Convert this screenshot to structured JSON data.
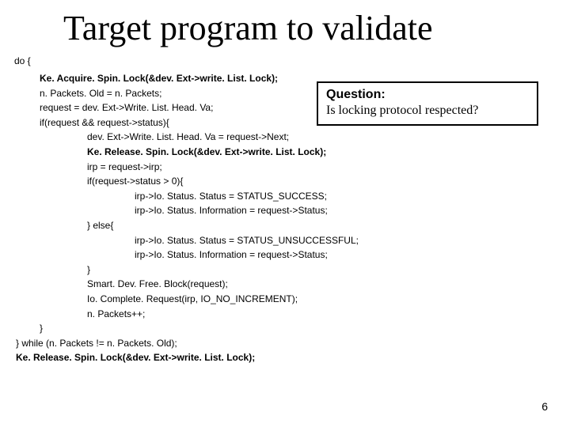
{
  "title": "Target program to validate",
  "do_label": "do {",
  "code": {
    "l1": "Ke. Acquire. Spin. Lock(&dev. Ext->write. List. Lock);",
    "l2": "n. Packets. Old = n. Packets;",
    "l3": "request = dev. Ext->Write. List. Head. Va;",
    "l4": "if(request && request->status){",
    "l5": "dev. Ext->Write. List. Head. Va = request->Next;",
    "l6": "Ke. Release. Spin. Lock(&dev. Ext->write. List. Lock);",
    "l7": "irp = request->irp;",
    "l8": "if(request->status > 0){",
    "l9": "irp->Io. Status. Status = STATUS_SUCCESS;",
    "l10": "irp->Io. Status. Information = request->Status;",
    "l11": "} else{",
    "l12": "irp->Io. Status. Status = STATUS_UNSUCCESSFUL;",
    "l13": "irp->Io. Status. Information = request->Status;",
    "l14": "}",
    "l15": "Smart. Dev. Free. Block(request);",
    "l16": "Io. Complete. Request(irp, IO_NO_INCREMENT);",
    "l17": "n. Packets++;",
    "l18": "}",
    "l19": "} while (n. Packets != n. Packets. Old);",
    "l20": "Ke. Release. Spin. Lock(&dev. Ext->write. List. Lock);"
  },
  "question": {
    "title": "Question:",
    "body": "Is locking protocol respected?"
  },
  "page_number": "6"
}
